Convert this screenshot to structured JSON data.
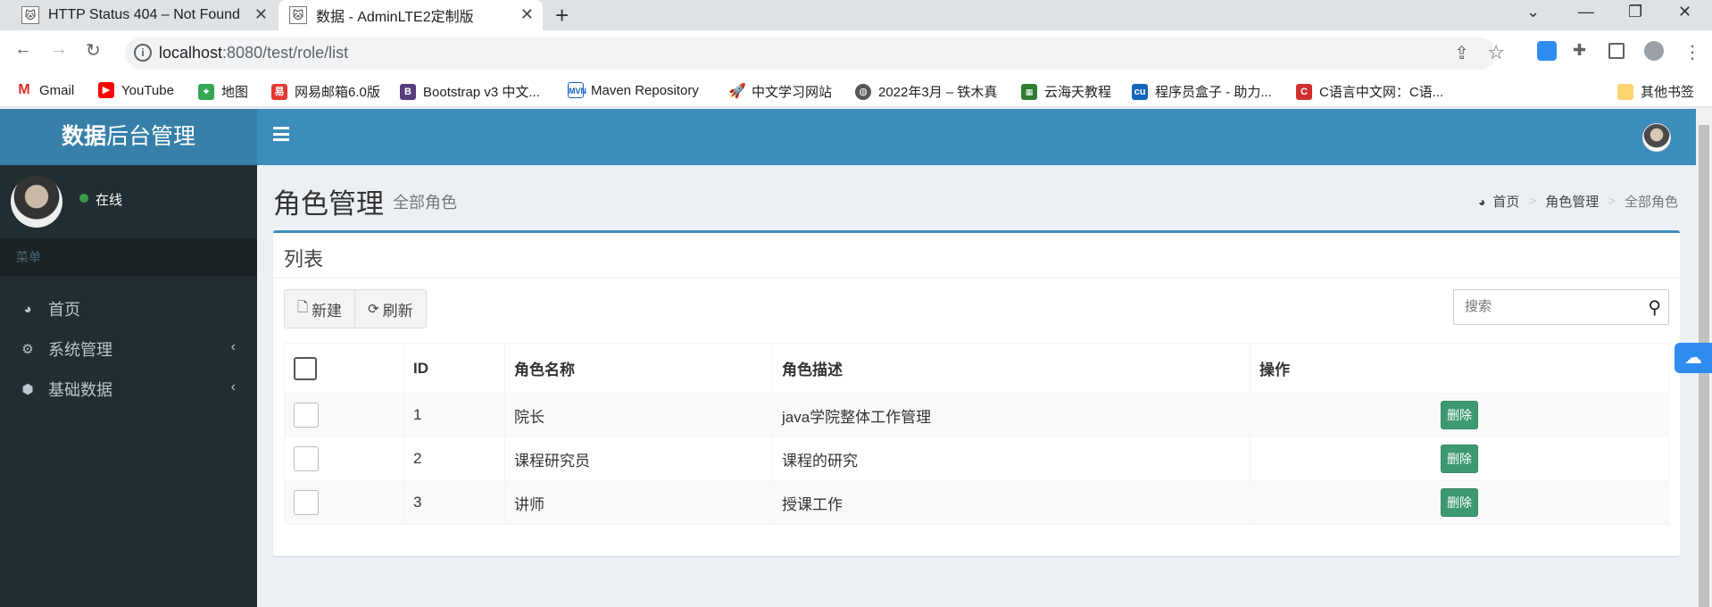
{
  "browser": {
    "tabs": [
      {
        "title": "HTTP Status 404 – Not Found",
        "active": false
      },
      {
        "title": "数据 - AdminLTE2定制版",
        "active": true
      }
    ],
    "new_tab": "+",
    "url_host": "localhost",
    "url_rest": ":8080/test/role/list",
    "bookmarks": [
      {
        "label": "Gmail",
        "icon": "gmail-icon"
      },
      {
        "label": "YouTube",
        "icon": "youtube-icon"
      },
      {
        "label": "地图",
        "icon": "maps-icon"
      },
      {
        "label": "网易邮箱6.0版",
        "icon": "netease-icon"
      },
      {
        "label": "Bootstrap v3 中文...",
        "icon": "bootstrap-icon"
      },
      {
        "label": "Maven Repository",
        "icon": "maven-icon"
      },
      {
        "label": "中文学习网站",
        "icon": "rocket-icon"
      },
      {
        "label": "2022年3月 – 铁木真",
        "icon": "globe-icon"
      },
      {
        "label": "云海天教程",
        "icon": "yunhaitian-icon"
      },
      {
        "label": "程序员盒子 - 助力...",
        "icon": "cu-icon"
      },
      {
        "label": "C语言中文网：C语...",
        "icon": "c-icon"
      },
      {
        "label": "其他书签",
        "icon": "folder-icon"
      }
    ]
  },
  "app": {
    "logo_bold": "数据",
    "logo_rest": "后台管理",
    "user_status": "在线",
    "menu_header": "菜单",
    "menu": [
      {
        "label": "首页",
        "icon": "dashboard-icon",
        "has_children": false
      },
      {
        "label": "系统管理",
        "icon": "cogs-icon",
        "has_children": true
      },
      {
        "label": "基础数据",
        "icon": "cube-icon",
        "has_children": true
      }
    ],
    "page_title": "角色管理",
    "page_subtitle": "全部角色",
    "breadcrumb": [
      "首页",
      "角色管理",
      "全部角色"
    ],
    "box_title": "列表",
    "buttons": {
      "new": "新建",
      "refresh": "刷新"
    },
    "search_placeholder": "搜索",
    "table": {
      "headers": [
        "ID",
        "角色名称",
        "角色描述",
        "操作"
      ],
      "rows": [
        {
          "id": "1",
          "name": "院长",
          "desc": "java学院整体工作管理",
          "action": "删除"
        },
        {
          "id": "2",
          "name": "课程研究员",
          "desc": "课程的研究",
          "action": "删除"
        },
        {
          "id": "3",
          "name": "讲师",
          "desc": "授课工作",
          "action": "删除"
        }
      ]
    }
  },
  "colors": {
    "header_blue": "#3c8dbc",
    "logo_blue": "#367fa9",
    "sidebar": "#222d32",
    "delete_green": "#3d9970"
  }
}
